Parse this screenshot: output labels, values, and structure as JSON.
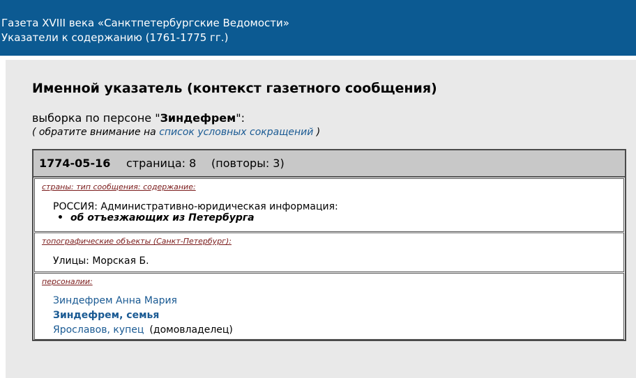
{
  "header": {
    "line1": "Газета XVIII века «Санктпетербургские Ведомости»",
    "line2": "Указатели к содержанию (1761-1775 гг.)"
  },
  "main": {
    "title": "Именной указатель (контекст газетного сообщения)",
    "selection_prefix": "выборка по персоне \"",
    "selection_name": "Зиндефрем",
    "selection_suffix": "\":",
    "note_prefix": "( обратите внимание на ",
    "note_link": "список условных сокращений",
    "note_suffix": " )"
  },
  "record": {
    "date": "1774-05-16",
    "page": "страница: 8",
    "repeats": "(повторы: 3)",
    "sections": {
      "countries": {
        "label": "страны: тип сообщения:   содержание:",
        "line": "РОССИЯ: Административно-юридическая информация:",
        "bullet": "об отъезжающих из Петербурга"
      },
      "topography": {
        "label": "топографические объекты (Санкт-Петербург):",
        "line": "Улицы: Морская Б."
      },
      "persons": {
        "label": "персоналии:",
        "items": [
          {
            "name": "Зиндефрем Анна Мария",
            "extra": ""
          },
          {
            "name": "Зиндефрем, семья",
            "extra": ""
          },
          {
            "name": "Ярославов, купец",
            "extra": "(домовладелец)"
          }
        ]
      }
    }
  }
}
